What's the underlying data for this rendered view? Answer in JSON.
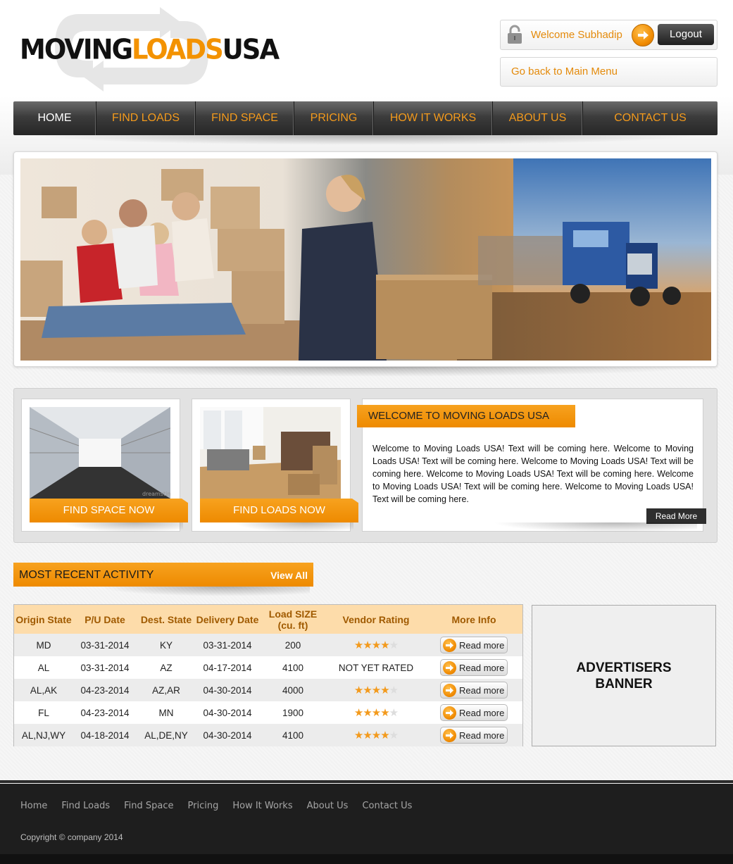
{
  "header": {
    "logo": {
      "word1": "MOVING",
      "word2": "LOADS",
      "word3": "USA"
    },
    "welcome_text": "Welcome Subhadip",
    "logout_label": "Logout",
    "main_menu_label": "Go back to Main Menu"
  },
  "nav": {
    "items": [
      {
        "label": "HOME",
        "active": true
      },
      {
        "label": "FIND LOADS"
      },
      {
        "label": "FIND SPACE"
      },
      {
        "label": "PRICING"
      },
      {
        "label": "HOW IT WORKS"
      },
      {
        "label": "ABOUT US"
      },
      {
        "label": "CONTACT US"
      }
    ]
  },
  "cards": {
    "find_space_label": "FIND SPACE NOW",
    "find_loads_label": "FIND LOADS NOW",
    "find_space_watermark": "dreamstime",
    "welcome_title": "WELCOME TO MOVING LOADS USA",
    "welcome_body": "Welcome to Moving Loads USA! Text will be coming here. Welcome to Moving Loads USA! Text will be coming here. Welcome to Moving Loads USA! Text will be coming here. Welcome to Moving Loads USA! Text will be coming here. Welcome to Moving Loads USA! Text will be coming here. Welcome to Moving Loads USA! Text will be coming here.",
    "read_more_label": "Read More"
  },
  "activity": {
    "title": "MOST RECENT ACTIVITY",
    "view_all_label": "View All",
    "columns": [
      "Origin State",
      "P/U Date",
      "Dest. State",
      "Delivery Date",
      "Load SIZE (cu. ft)",
      "Vendor Rating",
      "More Info"
    ],
    "rows": [
      {
        "origin": "MD",
        "pu_date": "03-31-2014",
        "dest": "KY",
        "delivery": "03-31-2014",
        "size": "200",
        "rating": 3.5,
        "rating_text": "",
        "more": "Read more"
      },
      {
        "origin": "AL",
        "pu_date": "03-31-2014",
        "dest": "AZ",
        "delivery": "04-17-2014",
        "size": "4100",
        "rating": 0,
        "rating_text": "NOT YET RATED",
        "more": "Read more"
      },
      {
        "origin": "AL,AK",
        "pu_date": "04-23-2014",
        "dest": "AZ,AR",
        "delivery": "04-30-2014",
        "size": "4000",
        "rating": 3.5,
        "rating_text": "",
        "more": "Read more"
      },
      {
        "origin": "FL",
        "pu_date": "04-23-2014",
        "dest": "MN",
        "delivery": "04-30-2014",
        "size": "1900",
        "rating": 3.5,
        "rating_text": "",
        "more": "Read more"
      },
      {
        "origin": "AL,NJ,WY",
        "pu_date": "04-18-2014",
        "dest": "AL,DE,NY",
        "delivery": "04-30-2014",
        "size": "4100",
        "rating": 3.5,
        "rating_text": "",
        "more": "Read more"
      }
    ]
  },
  "advertiser": {
    "label": "ADVERTISERS\nBANNER"
  },
  "footer": {
    "links": [
      "Home",
      "Find Loads",
      "Find Space",
      "Pricing",
      "How It Works",
      "About Us",
      "Contact Us"
    ],
    "copyright": "Copyright © company 2014"
  },
  "colors": {
    "accent": "#f39200",
    "nav_dark": "#2e2e2e",
    "header_row": "#fddcaa"
  }
}
